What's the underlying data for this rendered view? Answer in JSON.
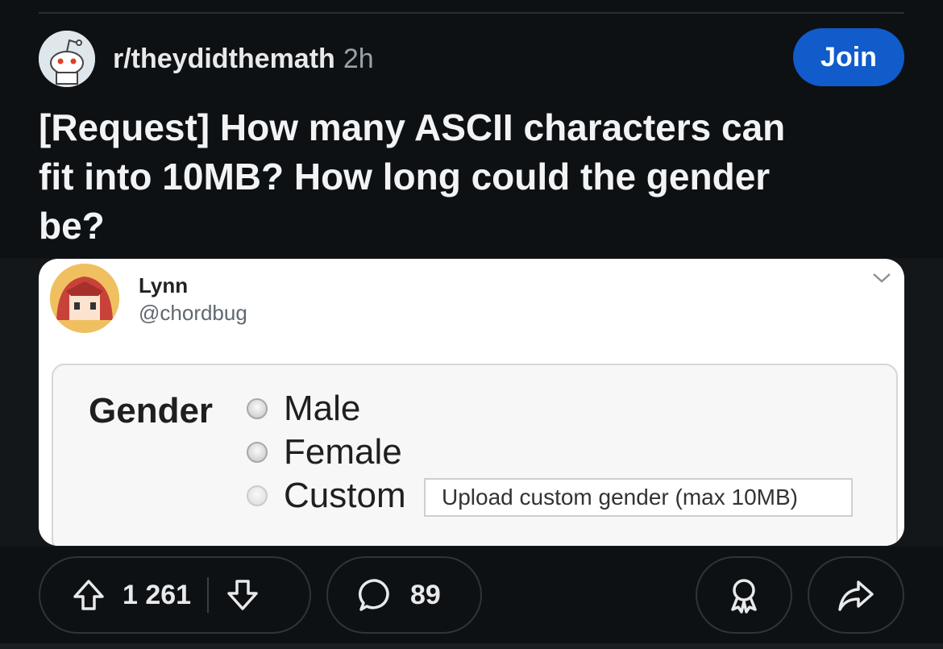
{
  "post": {
    "subreddit": "r/theydidthemath",
    "age": "2h",
    "join_label": "Join",
    "title_lines": [
      "[Request] How many ASCII characters can",
      "fit into 10MB? How long could the gender",
      "be?"
    ]
  },
  "tweet": {
    "name": "Lynn",
    "handle": "@chordbug",
    "form": {
      "label": "Gender",
      "options": [
        "Male",
        "Female",
        "Custom"
      ],
      "custom_field_placeholder": "Upload custom gender (max 10MB)"
    }
  },
  "actions": {
    "upvotes": "1 261",
    "comments": "89"
  },
  "colors": {
    "background": "#0e1113",
    "join_button": "#115bca",
    "card": "#ffffff"
  }
}
